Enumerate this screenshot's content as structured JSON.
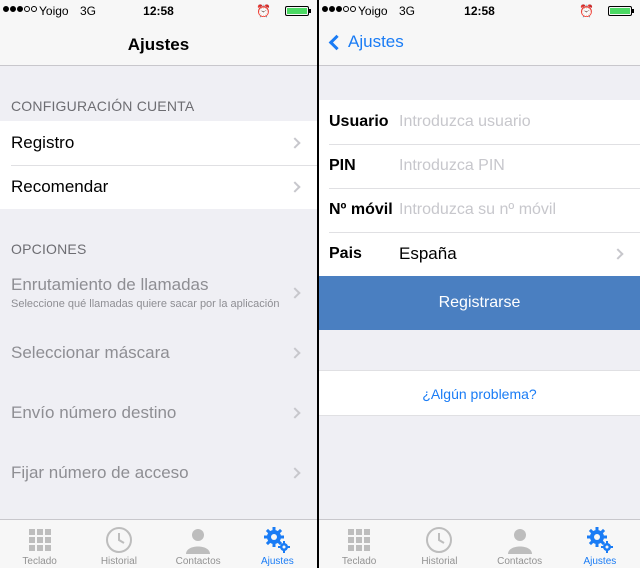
{
  "status": {
    "carrier": "Yoigo",
    "network": "3G",
    "time": "12:58",
    "alarm_icon": "alarm-icon",
    "battery_percent": 100,
    "battery_color": "#4cd964"
  },
  "left": {
    "nav_title": "Ajustes",
    "account_header": "CONFIGURACIÓN CUENTA",
    "account_items": [
      {
        "label": "Registro"
      },
      {
        "label": "Recomendar"
      }
    ],
    "options_header": "OPCIONES",
    "options_items": [
      {
        "label": "Enrutamiento de llamadas",
        "sub": "Seleccione qué llamadas quiere sacar por la aplicación"
      },
      {
        "label": "Seleccionar máscara"
      },
      {
        "label": "Envío número destino"
      },
      {
        "label": "Fijar número de acceso"
      }
    ]
  },
  "right": {
    "back_label": "Ajustes",
    "fields": [
      {
        "label": "Usuario",
        "placeholder": "Introduzca usuario"
      },
      {
        "label": "PIN",
        "placeholder": "Introduzca PIN"
      },
      {
        "label": "Nº móvil",
        "placeholder": "Introduzca su nº móvil"
      }
    ],
    "country_label": "Pais",
    "country_value": "España",
    "register_label": "Registrarse",
    "help_link": "¿Algún problema?"
  },
  "tabs": [
    {
      "label": "Teclado",
      "icon": "keypad-icon"
    },
    {
      "label": "Historial",
      "icon": "clock-icon"
    },
    {
      "label": "Contactos",
      "icon": "person-icon"
    },
    {
      "label": "Ajustes",
      "icon": "gears-icon",
      "active": true
    }
  ],
  "colors": {
    "accent": "#1a7cf5",
    "button": "#4a7fc1",
    "background": "#efeff4"
  }
}
